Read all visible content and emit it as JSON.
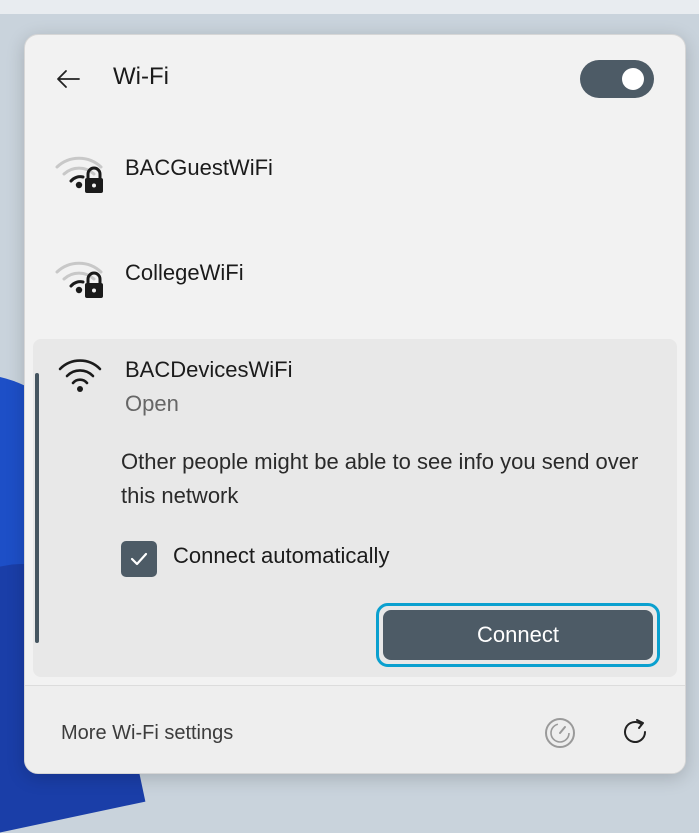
{
  "header": {
    "title": "Wi-Fi",
    "wifi_on": true
  },
  "networks": [
    {
      "name": "BACGuestWiFi",
      "secured": true
    },
    {
      "name": "CollegeWiFi",
      "secured": true
    }
  ],
  "expanded_network": {
    "name": "BACDevicesWiFi",
    "status": "Open",
    "warning": "Other people might be able to see info you send over this network",
    "connect_automatically_label": "Connect automatically",
    "connect_automatically_checked": true,
    "connect_label": "Connect"
  },
  "footer": {
    "more_settings_label": "More Wi-Fi settings"
  },
  "icons": {
    "back": "arrow-left-icon",
    "secured_wifi": "wifi-lock-icon",
    "open_wifi": "wifi-icon",
    "check": "checkmark-icon",
    "speed": "gauge-icon",
    "refresh": "refresh-icon"
  },
  "colors": {
    "accent": "#4d5b66",
    "focus_ring": "#0aa0cf",
    "panel_bg": "#f2f2f2",
    "expanded_bg": "#e8e8e8"
  }
}
